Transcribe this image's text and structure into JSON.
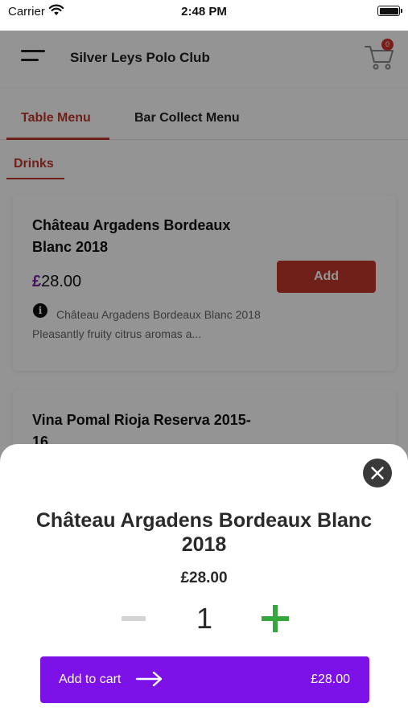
{
  "status_bar": {
    "carrier": "Carrier",
    "time": "2:48 PM"
  },
  "header": {
    "title": "Silver Leys Polo Club",
    "cart_count": "0"
  },
  "tabs": [
    {
      "label": "Table Menu",
      "active": true
    },
    {
      "label": "Bar Collect Menu",
      "active": false
    }
  ],
  "subtabs": [
    {
      "label": "Drinks",
      "active": true
    }
  ],
  "products": [
    {
      "title": "Château Argadens Bordeaux Blanc 2018",
      "currency": "£",
      "price": "28.00",
      "add_label": "Add",
      "info_icon": "i",
      "description": "Château Argadens Bordeaux Blanc 2018 Pleasantly fruity citrus aromas a..."
    },
    {
      "title": "Vina Pomal Rioja Reserva 2015-16"
    }
  ],
  "sheet": {
    "title": "Château Argadens Bordeaux Blanc 2018",
    "price": "£28.00",
    "quantity": "1",
    "add_to_cart_label": "Add to cart",
    "total": "£28.00"
  },
  "colors": {
    "accent_red": "#c0392b",
    "purple": "#7d12e8",
    "plus_green": "#36a73c",
    "badge_red": "#d0312d"
  },
  "icons": [
    "wifi-icon",
    "battery-icon",
    "menu-icon",
    "cart-icon",
    "info-icon",
    "close-icon",
    "minus-icon",
    "plus-icon",
    "arrow-right-icon"
  ]
}
